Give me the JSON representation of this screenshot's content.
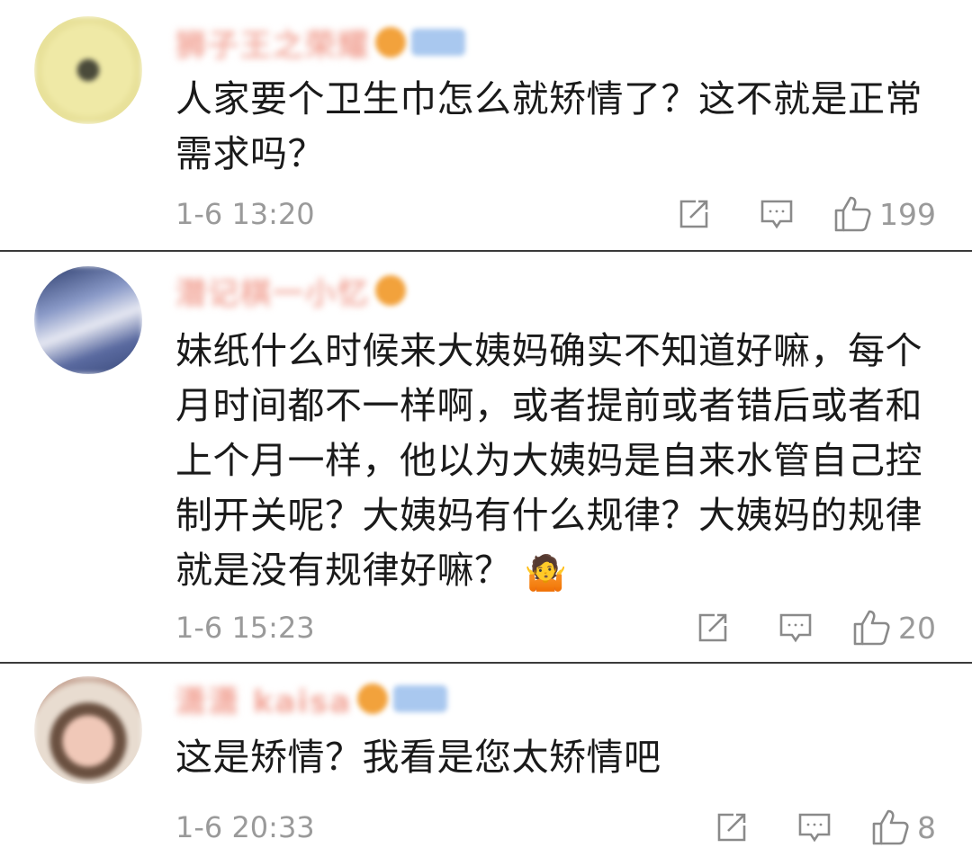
{
  "comments": [
    {
      "username": "狮子王之荣耀",
      "text": "人家要个卫生巾怎么就矫情了？这不就是正常需求吗？",
      "time": "1-6 13:20",
      "likes": "199",
      "avatar_color": "#e8e19a",
      "emoji": ""
    },
    {
      "username": "潜记棋一小忆",
      "text": "妹纸什么时候来大姨妈确实不知道好嘛，每个月时间都不一样啊，或者提前或者错后或者和上个月一样，他以为大姨妈是自来水管自己控制开关呢？大姨妈有什么规律？大姨妈的规律就是没有规律好嘛？",
      "time": "1-6 15:23",
      "likes": "20",
      "avatar_color": "#5a6a9a",
      "emoji": "🤷"
    },
    {
      "username": "潇潇 kaisa",
      "text": "这是矫情？我看是您太矫情吧",
      "time": "1-6 20:33",
      "likes": "8",
      "avatar_color": "#d8c0b0",
      "emoji": ""
    }
  ],
  "icons": {
    "share": "share-icon",
    "comment": "comment-icon",
    "like": "thumbs-up-icon"
  }
}
